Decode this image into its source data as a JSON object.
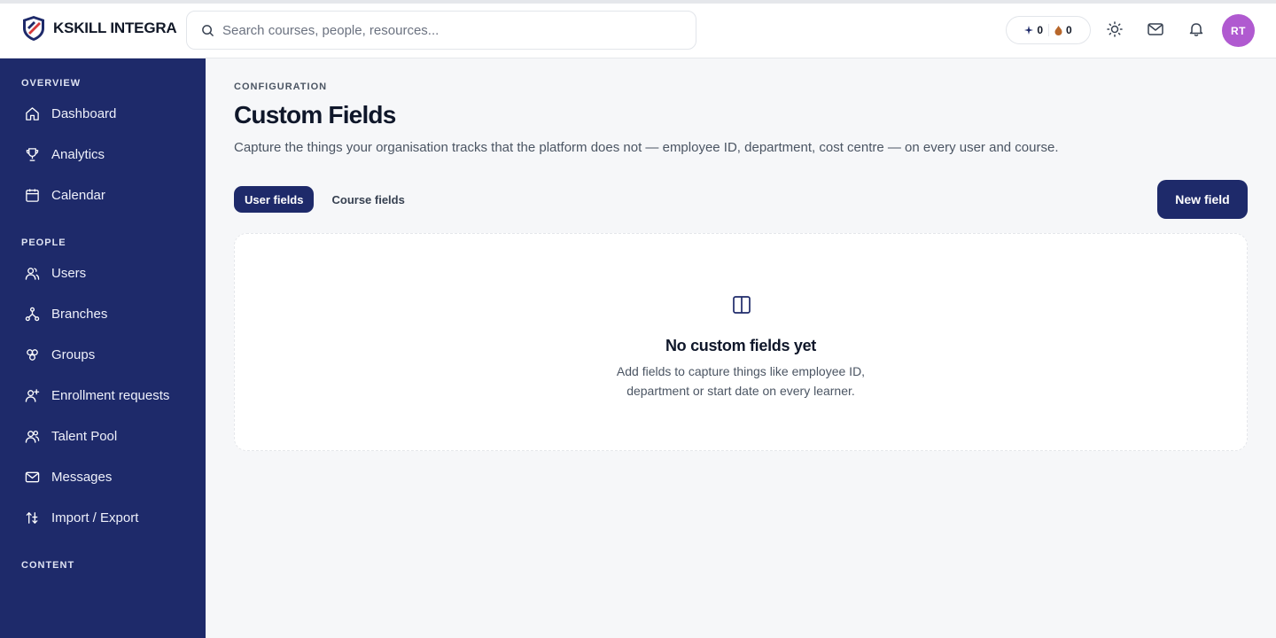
{
  "brand": {
    "name": "KSKILL INTEGRA"
  },
  "search": {
    "placeholder": "Search courses, people, resources..."
  },
  "header": {
    "stats": [
      {
        "icon": "sparkle-icon",
        "value": "0"
      },
      {
        "icon": "flame-icon",
        "value": "0"
      }
    ],
    "avatar_initials": "RT",
    "avatar_color": "#b05ad0"
  },
  "sidebar": {
    "sections": [
      {
        "label": "OVERVIEW",
        "items": [
          {
            "label": "Dashboard",
            "icon": "home-icon"
          },
          {
            "label": "Analytics",
            "icon": "trophy-icon"
          },
          {
            "label": "Calendar",
            "icon": "calendar-icon"
          }
        ]
      },
      {
        "label": "PEOPLE",
        "items": [
          {
            "label": "Users",
            "icon": "users-icon"
          },
          {
            "label": "Branches",
            "icon": "branches-icon"
          },
          {
            "label": "Groups",
            "icon": "groups-icon"
          },
          {
            "label": "Enrollment requests",
            "icon": "user-plus-icon"
          },
          {
            "label": "Talent Pool",
            "icon": "talent-pool-icon"
          },
          {
            "label": "Messages",
            "icon": "mail-icon"
          },
          {
            "label": "Import / Export",
            "icon": "import-export-icon"
          }
        ]
      },
      {
        "label": "CONTENT",
        "items": []
      }
    ]
  },
  "main": {
    "eyebrow": "CONFIGURATION",
    "title": "Custom Fields",
    "description": "Capture the things your organisation tracks that the platform does not — employee ID, department, cost centre — on every user and course.",
    "tabs": [
      {
        "label": "User fields",
        "active": true
      },
      {
        "label": "Course fields",
        "active": false
      }
    ],
    "new_button": "New field",
    "empty_state": {
      "title": "No custom fields yet",
      "line1": "Add fields to capture things like employee ID,",
      "line2": "department or start date on every learner."
    }
  },
  "colors": {
    "sidebar": "#1e2a6a",
    "accent": "#1e2a6a",
    "background": "#f6f7f9"
  }
}
